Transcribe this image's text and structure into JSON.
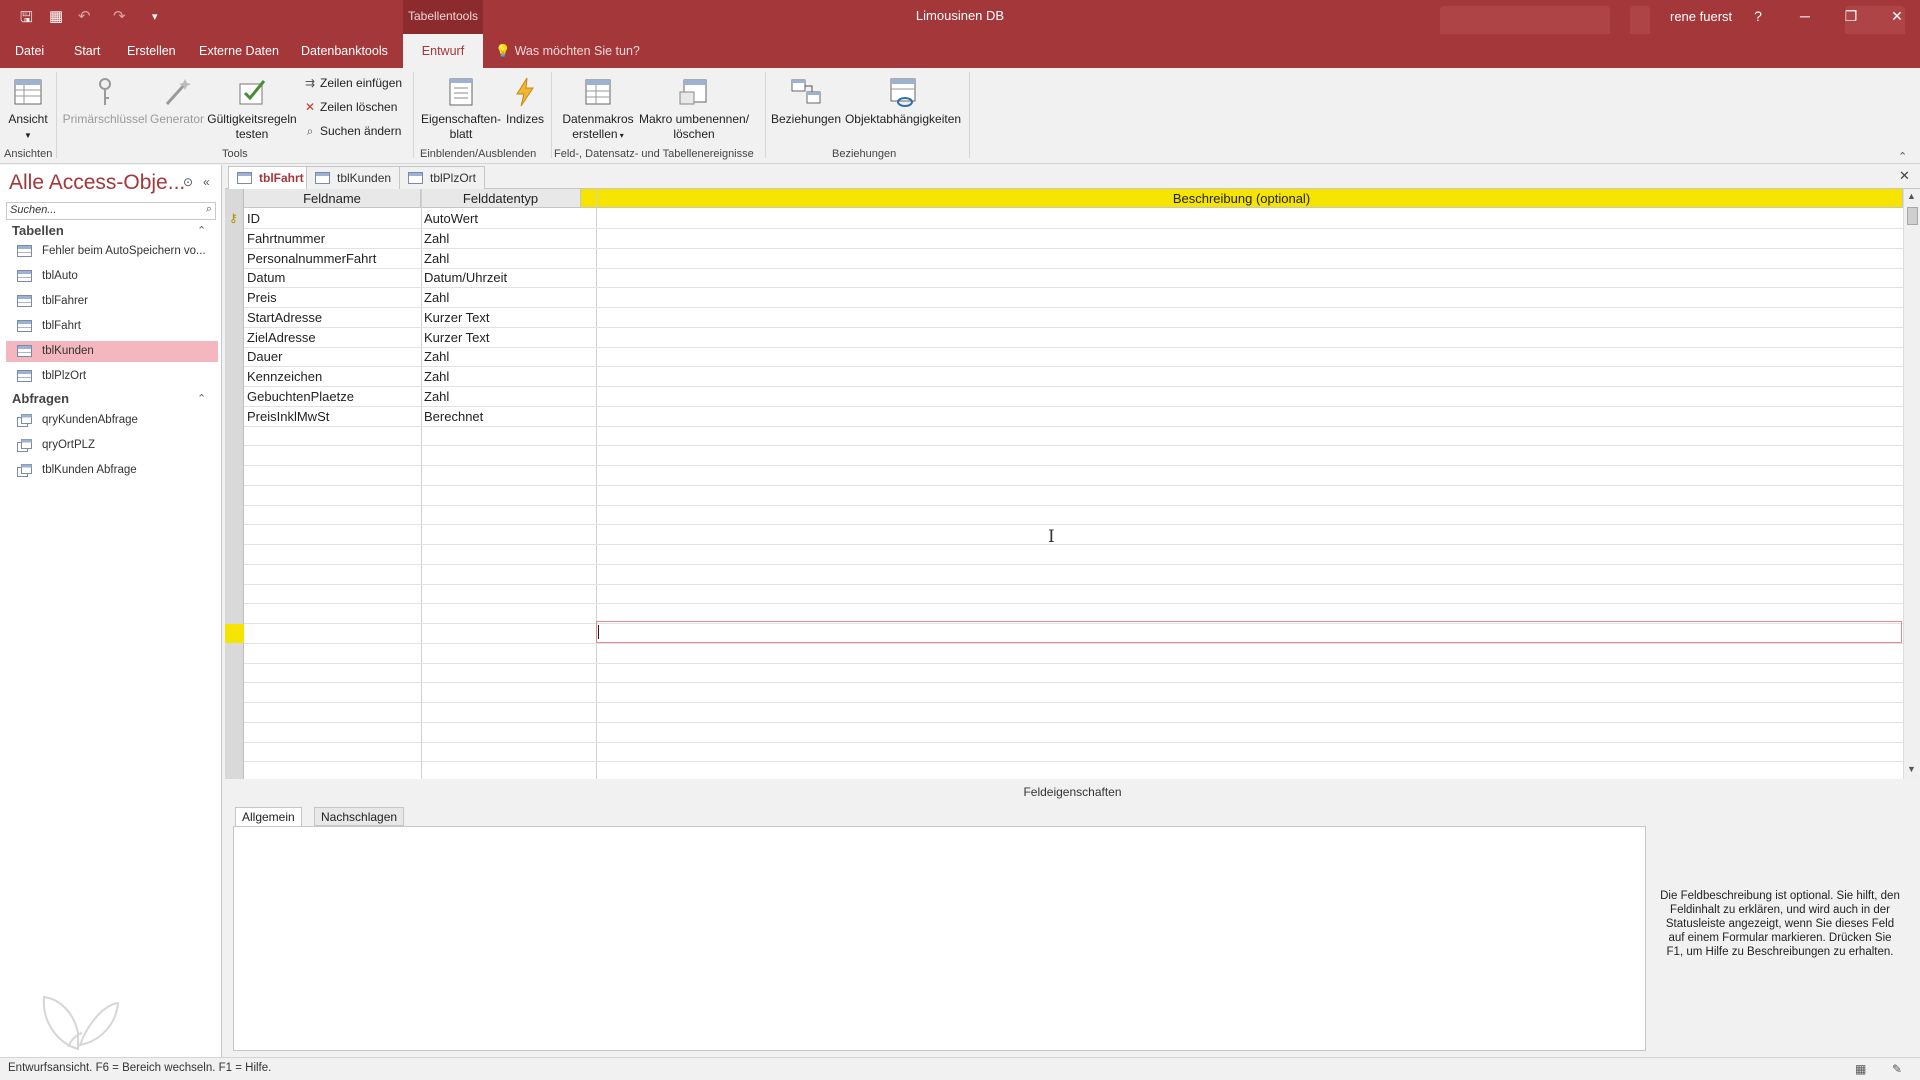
{
  "titlebar": {
    "context_tab": "Tabellentools",
    "title": "Limousinen DB",
    "user": "rene fuerst",
    "help": "?",
    "minimize": "─",
    "restore": "❐",
    "close": "✕",
    "qa_save": "🖫",
    "qa_view": "▦",
    "qa_undo": "↶",
    "qa_redo": "↷",
    "qa_customize": "▾"
  },
  "ribbon_tabs": [
    "Datei",
    "Start",
    "Erstellen",
    "Externe Daten",
    "Datenbanktools",
    "Entwurf"
  ],
  "tell_me": "Was möchten Sie tun?",
  "ribbon": {
    "ansicht": "Ansicht",
    "primaerschluessel": "Primärschlüssel",
    "generator": "Generator",
    "gueltigkeit": "Gültigkeitsregeln testen",
    "zeilen_einfuegen": "Zeilen einfügen",
    "zeilen_loeschen": "Zeilen löschen",
    "suchen_aendern": "Suchen ändern",
    "eigenschaftenblatt": "Eigenschaften-blatt",
    "indizes": "Indizes",
    "datenmakros": "Datenmakros erstellen",
    "makro_umbenennen": "Makro umbenennen/ löschen",
    "beziehungen": "Beziehungen",
    "objektabh": "Objektabhängigkeiten",
    "groups": {
      "ansichten": "Ansichten",
      "tools": "Tools",
      "einblenden": "Einblenden/Ausblenden",
      "ereignisse": "Feld-, Datensatz- und Tabellenereignisse",
      "beziehungen": "Beziehungen"
    }
  },
  "nav": {
    "title": "Alle Access-Obje...",
    "search_placeholder": "Suchen...",
    "groups": {
      "tabellen": "Tabellen",
      "abfragen": "Abfragen"
    },
    "tables": [
      "Fehler beim AutoSpeichern vo...",
      "tblAuto",
      "tblFahrer",
      "tblFahrt",
      "tblKunden",
      "tblPlzOrt"
    ],
    "queries": [
      "qryKundenAbfrage",
      "qryOrtPLZ",
      "tblKunden Abfrage"
    ]
  },
  "doc_tabs": [
    "tblFahrt",
    "tblKunden",
    "tblPlzOrt"
  ],
  "grid": {
    "headers": [
      "Feldname",
      "Felddatentyp",
      "Beschreibung (optional)"
    ],
    "rows": [
      {
        "name": "ID",
        "type": "AutoWert"
      },
      {
        "name": "Fahrtnummer",
        "type": "Zahl"
      },
      {
        "name": "PersonalnummerFahrt",
        "type": "Zahl"
      },
      {
        "name": "Datum",
        "type": "Datum/Uhrzeit"
      },
      {
        "name": "Preis",
        "type": "Zahl"
      },
      {
        "name": "StartAdresse",
        "type": "Kurzer Text"
      },
      {
        "name": "ZielAdresse",
        "type": "Kurzer Text"
      },
      {
        "name": "Dauer",
        "type": "Zahl"
      },
      {
        "name": "Kennzeichen",
        "type": "Zahl"
      },
      {
        "name": "GebuchtenPlaetze",
        "type": "Zahl"
      },
      {
        "name": "PreisInklMwSt",
        "type": "Berechnet"
      }
    ]
  },
  "properties": {
    "title": "Feldeigenschaften",
    "tabs": [
      "Allgemein",
      "Nachschlagen"
    ],
    "help": "Die Feldbeschreibung ist optional. Sie hilft, den Feldinhalt zu erklären, und wird auch in der Statusleiste angezeigt, wenn Sie dieses Feld auf einem Formular markieren. Drücken Sie F1, um Hilfe zu Beschreibungen zu erhalten."
  },
  "statusbar": {
    "text": "Entwurfsansicht. F6 = Bereich wechseln. F1 = Hilfe."
  },
  "colors": {
    "accent": "#a4373a",
    "header_highlight": "#f5e400",
    "nav_selected": "#f4b6bf"
  }
}
